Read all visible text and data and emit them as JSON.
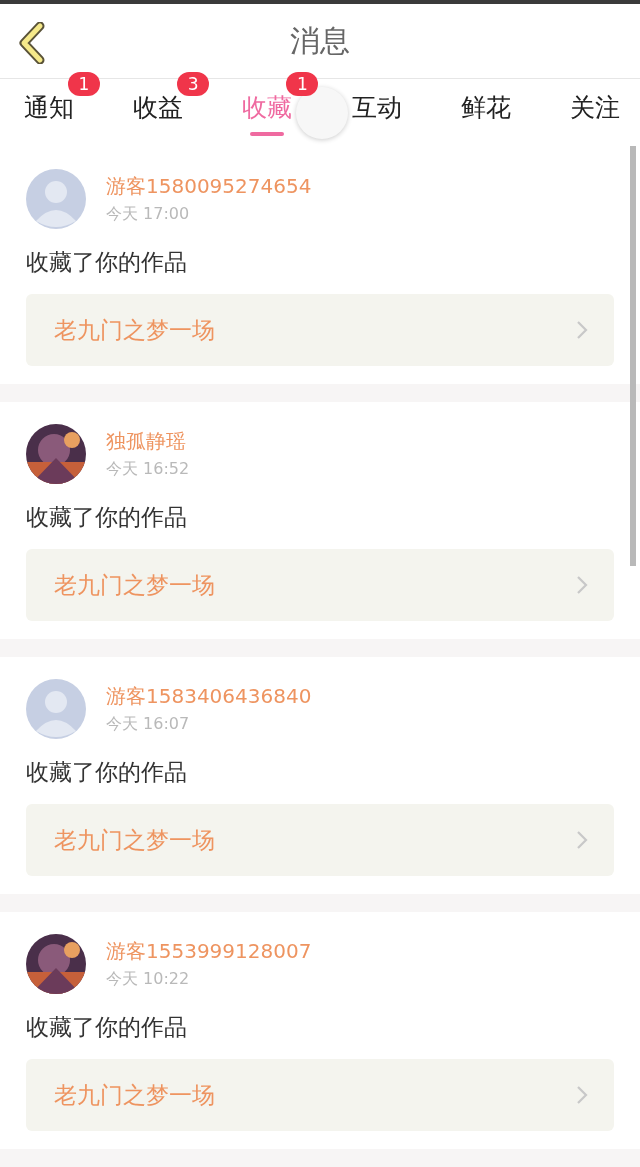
{
  "header": {
    "title": "消息"
  },
  "tabs": [
    {
      "label": "通知",
      "selected": false,
      "badge": "1"
    },
    {
      "label": "收益",
      "selected": false,
      "badge": "3"
    },
    {
      "label": "收藏",
      "selected": true,
      "badge": "1"
    },
    {
      "label": "互动",
      "selected": false
    },
    {
      "label": "鲜花",
      "selected": false
    },
    {
      "label": "关注",
      "selected": false
    }
  ],
  "messages": [
    {
      "kind": "default",
      "name": "游客1580095274654",
      "time": "今天 17:00",
      "action": "收藏了你的作品",
      "work": "老九门之梦一场"
    },
    {
      "kind": "picture",
      "name": "独孤静瑶",
      "time": "今天 16:52",
      "action": "收藏了你的作品",
      "work": "老九门之梦一场"
    },
    {
      "kind": "default",
      "name": "游客1583406436840",
      "time": "今天 16:07",
      "action": "收藏了你的作品",
      "work": "老九门之梦一场"
    },
    {
      "kind": "picture",
      "name": "游客1553999128007",
      "time": "今天 10:22",
      "action": "收藏了你的作品",
      "work": "老九门之梦一场"
    }
  ]
}
